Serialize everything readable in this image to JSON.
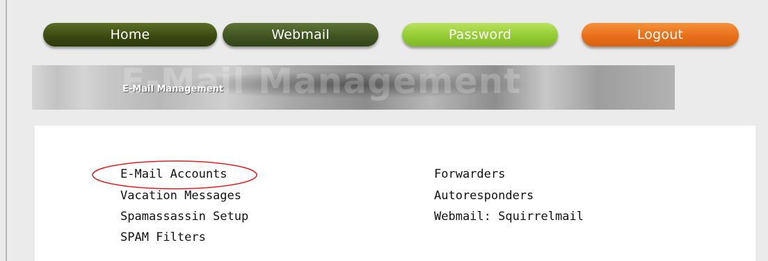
{
  "nav": {
    "home": "Home",
    "webmail": "Webmail",
    "password": "Password",
    "logout": "Logout"
  },
  "banner": {
    "title": "E-Mail Management",
    "ghost": "E-Mail Management"
  },
  "left_column": [
    "E-Mail Accounts",
    "Vacation Messages",
    "Spamassassin Setup",
    "SPAM Filters"
  ],
  "right_column": [
    "Forwarders",
    "Autoresponders",
    "Webmail: Squirrelmail"
  ],
  "colors": {
    "home": "#3a4710",
    "webmail": "#3e5220",
    "password": "#93cc33",
    "logout": "#e8701a",
    "highlight": "#e02020"
  }
}
